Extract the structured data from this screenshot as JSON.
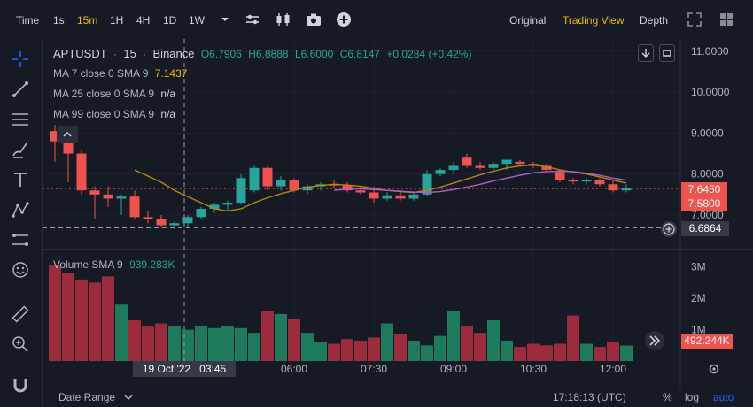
{
  "toolbar": {
    "timeframes": [
      "Time",
      "1s",
      "15m",
      "1H",
      "4H",
      "1D",
      "1W"
    ],
    "active_timeframe": "15m",
    "views": [
      "Original",
      "Trading View",
      "Depth"
    ],
    "active_view": "Trading View"
  },
  "legend": {
    "symbol": "APTUSDT",
    "interval": "15",
    "exchange": "Binance",
    "open": "O6.7906",
    "high": "H6.8888",
    "low": "L6.6000",
    "close": "C6.8147",
    "change": "+0.0284 (+0.42%)",
    "ma7_label": "MA 7 close 0 SMA 9",
    "ma7_value": "7.1437",
    "ma25_label": "MA 25 close 0 SMA 9",
    "ma25_value": "n/a",
    "ma99_label": "MA 99 close 0 SMA 9",
    "ma99_value": "n/a",
    "volume_label": "Volume SMA 9",
    "volume_value": "939.283K"
  },
  "price_axis": {
    "ticks": [
      "11.0000",
      "10.0000",
      "9.0000",
      "8.0000",
      "7.0000"
    ],
    "last_price": "7.6450",
    "ma_price": "7.5800",
    "crosshair_price": "6.6864"
  },
  "volume_axis": {
    "ticks": [
      "3M",
      "2M",
      "1M"
    ],
    "last_volume": "492.244K"
  },
  "time_axis": {
    "ticks": [
      "06:00",
      "07:30",
      "09:00",
      "10:30",
      "12:00"
    ],
    "crosshair_date": "19 Oct '22",
    "crosshair_time": "03:45"
  },
  "bottom": {
    "date_range": "Date Range",
    "clock": "17:18:13 (UTC)",
    "percent": "%",
    "log": "log",
    "auto": "auto"
  },
  "colors": {
    "up": "#26a69a",
    "down": "#ef5350",
    "accent": "#f0b90b",
    "ma7": "#b8860b",
    "ma25": "#b05cc8"
  },
  "chart_data": {
    "type": "candlestick",
    "price_ylim": [
      6.2,
      11.3
    ],
    "volume_ylim": [
      0,
      3500000
    ],
    "candles": [
      {
        "o": 9.05,
        "h": 9.2,
        "l": 8.3,
        "c": 8.8
      },
      {
        "o": 8.8,
        "h": 8.9,
        "l": 7.8,
        "c": 8.5
      },
      {
        "o": 8.5,
        "h": 8.6,
        "l": 7.5,
        "c": 7.6
      },
      {
        "o": 7.6,
        "h": 7.7,
        "l": 6.9,
        "c": 7.5
      },
      {
        "o": 7.5,
        "h": 7.7,
        "l": 7.2,
        "c": 7.4
      },
      {
        "o": 7.4,
        "h": 7.5,
        "l": 7.0,
        "c": 7.45
      },
      {
        "o": 7.45,
        "h": 7.6,
        "l": 6.9,
        "c": 6.95
      },
      {
        "o": 6.95,
        "h": 7.1,
        "l": 6.8,
        "c": 6.9
      },
      {
        "o": 6.9,
        "h": 7.0,
        "l": 6.7,
        "c": 6.75
      },
      {
        "o": 6.75,
        "h": 6.85,
        "l": 6.65,
        "c": 6.8
      },
      {
        "o": 6.8,
        "h": 7.0,
        "l": 6.7,
        "c": 6.95
      },
      {
        "o": 6.95,
        "h": 7.2,
        "l": 6.9,
        "c": 7.15
      },
      {
        "o": 7.15,
        "h": 7.3,
        "l": 7.05,
        "c": 7.25
      },
      {
        "o": 7.25,
        "h": 7.35,
        "l": 7.1,
        "c": 7.3
      },
      {
        "o": 7.3,
        "h": 8.0,
        "l": 7.25,
        "c": 7.9
      },
      {
        "o": 7.6,
        "h": 8.2,
        "l": 7.55,
        "c": 8.15
      },
      {
        "o": 8.15,
        "h": 8.2,
        "l": 7.6,
        "c": 7.7
      },
      {
        "o": 7.7,
        "h": 7.95,
        "l": 7.6,
        "c": 7.85
      },
      {
        "o": 7.85,
        "h": 7.9,
        "l": 7.55,
        "c": 7.6
      },
      {
        "o": 7.6,
        "h": 7.75,
        "l": 7.5,
        "c": 7.7
      },
      {
        "o": 7.7,
        "h": 7.8,
        "l": 7.6,
        "c": 7.75
      },
      {
        "o": 7.75,
        "h": 7.85,
        "l": 7.65,
        "c": 7.72
      },
      {
        "o": 7.72,
        "h": 7.8,
        "l": 7.55,
        "c": 7.6
      },
      {
        "o": 7.6,
        "h": 7.7,
        "l": 7.5,
        "c": 7.55
      },
      {
        "o": 7.55,
        "h": 7.7,
        "l": 7.3,
        "c": 7.4
      },
      {
        "o": 7.4,
        "h": 7.55,
        "l": 7.35,
        "c": 7.48
      },
      {
        "o": 7.48,
        "h": 7.6,
        "l": 7.35,
        "c": 7.4
      },
      {
        "o": 7.4,
        "h": 7.55,
        "l": 7.35,
        "c": 7.5
      },
      {
        "o": 7.5,
        "h": 8.1,
        "l": 7.45,
        "c": 8.0
      },
      {
        "o": 8.0,
        "h": 8.15,
        "l": 7.95,
        "c": 8.1
      },
      {
        "o": 8.1,
        "h": 8.3,
        "l": 8.0,
        "c": 8.2
      },
      {
        "o": 8.4,
        "h": 8.5,
        "l": 8.15,
        "c": 8.2
      },
      {
        "o": 8.2,
        "h": 8.3,
        "l": 8.1,
        "c": 8.15
      },
      {
        "o": 8.15,
        "h": 8.3,
        "l": 8.1,
        "c": 8.25
      },
      {
        "o": 8.25,
        "h": 8.35,
        "l": 8.1,
        "c": 8.35
      },
      {
        "o": 8.3,
        "h": 8.35,
        "l": 8.2,
        "c": 8.25
      },
      {
        "o": 8.25,
        "h": 8.3,
        "l": 8.15,
        "c": 8.2
      },
      {
        "o": 8.2,
        "h": 8.25,
        "l": 8.05,
        "c": 8.1
      },
      {
        "o": 8.05,
        "h": 8.1,
        "l": 7.8,
        "c": 7.85
      },
      {
        "o": 7.85,
        "h": 7.9,
        "l": 7.75,
        "c": 7.82
      },
      {
        "o": 7.82,
        "h": 7.9,
        "l": 7.75,
        "c": 7.85
      },
      {
        "o": 7.85,
        "h": 7.9,
        "l": 7.7,
        "c": 7.75
      },
      {
        "o": 7.75,
        "h": 7.85,
        "l": 7.55,
        "c": 7.6
      },
      {
        "o": 7.6,
        "h": 7.75,
        "l": 7.55,
        "c": 7.65
      }
    ],
    "volumes": [
      3050000,
      2800000,
      2600000,
      2500000,
      2700000,
      1800000,
      1300000,
      1100000,
      1200000,
      1100000,
      1000000,
      1100000,
      1050000,
      1100000,
      1050000,
      900000,
      1600000,
      1500000,
      1350000,
      900000,
      600000,
      550000,
      700000,
      650000,
      750000,
      1200000,
      850000,
      650000,
      500000,
      800000,
      1600000,
      1100000,
      900000,
      1300000,
      650000,
      450000,
      550000,
      500000,
      550000,
      1450000,
      550000,
      450000,
      600000,
      492244
    ],
    "ma7": [
      null,
      null,
      null,
      null,
      null,
      null,
      8.1,
      7.95,
      7.8,
      7.6,
      7.45,
      7.3,
      7.15,
      7.1,
      7.15,
      7.3,
      7.42,
      7.52,
      7.6,
      7.68,
      7.72,
      7.75,
      7.73,
      7.7,
      7.65,
      7.6,
      7.57,
      7.55,
      7.6,
      7.68,
      7.78,
      7.88,
      7.98,
      8.07,
      8.15,
      8.2,
      8.22,
      8.18,
      8.1,
      8.05,
      8.0,
      7.93,
      7.85,
      7.78
    ],
    "ma7_sma9": [
      null,
      null,
      null,
      null,
      null,
      null,
      null,
      null,
      null,
      null,
      null,
      null,
      null,
      null,
      null,
      null,
      null,
      null,
      null,
      null,
      null,
      7.6,
      7.63,
      7.64,
      7.62,
      7.6,
      7.58,
      7.56,
      7.55,
      7.57,
      7.62,
      7.68,
      7.75,
      7.83,
      7.9,
      7.97,
      8.03,
      8.06,
      8.07,
      8.06,
      8.02,
      7.97,
      7.9,
      7.85
    ]
  }
}
